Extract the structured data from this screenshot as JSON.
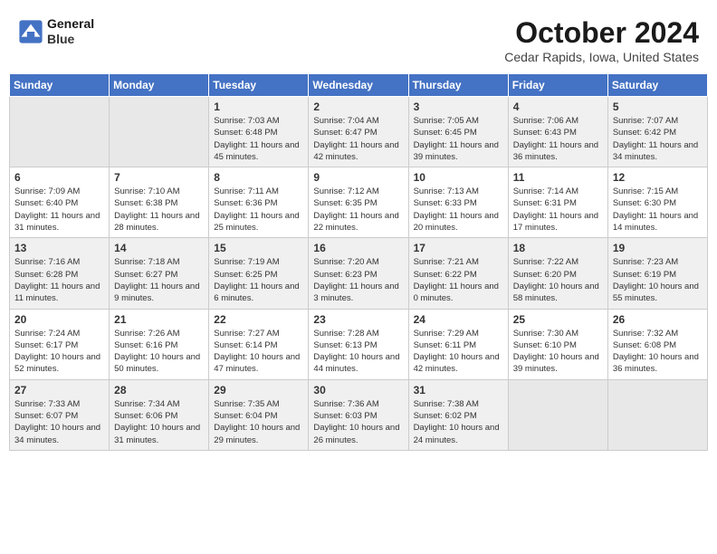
{
  "header": {
    "logo_line1": "General",
    "logo_line2": "Blue",
    "month": "October 2024",
    "location": "Cedar Rapids, Iowa, United States"
  },
  "weekdays": [
    "Sunday",
    "Monday",
    "Tuesday",
    "Wednesday",
    "Thursday",
    "Friday",
    "Saturday"
  ],
  "weeks": [
    [
      {
        "day": "",
        "info": ""
      },
      {
        "day": "",
        "info": ""
      },
      {
        "day": "1",
        "info": "Sunrise: 7:03 AM\nSunset: 6:48 PM\nDaylight: 11 hours and 45 minutes."
      },
      {
        "day": "2",
        "info": "Sunrise: 7:04 AM\nSunset: 6:47 PM\nDaylight: 11 hours and 42 minutes."
      },
      {
        "day": "3",
        "info": "Sunrise: 7:05 AM\nSunset: 6:45 PM\nDaylight: 11 hours and 39 minutes."
      },
      {
        "day": "4",
        "info": "Sunrise: 7:06 AM\nSunset: 6:43 PM\nDaylight: 11 hours and 36 minutes."
      },
      {
        "day": "5",
        "info": "Sunrise: 7:07 AM\nSunset: 6:42 PM\nDaylight: 11 hours and 34 minutes."
      }
    ],
    [
      {
        "day": "6",
        "info": "Sunrise: 7:09 AM\nSunset: 6:40 PM\nDaylight: 11 hours and 31 minutes."
      },
      {
        "day": "7",
        "info": "Sunrise: 7:10 AM\nSunset: 6:38 PM\nDaylight: 11 hours and 28 minutes."
      },
      {
        "day": "8",
        "info": "Sunrise: 7:11 AM\nSunset: 6:36 PM\nDaylight: 11 hours and 25 minutes."
      },
      {
        "day": "9",
        "info": "Sunrise: 7:12 AM\nSunset: 6:35 PM\nDaylight: 11 hours and 22 minutes."
      },
      {
        "day": "10",
        "info": "Sunrise: 7:13 AM\nSunset: 6:33 PM\nDaylight: 11 hours and 20 minutes."
      },
      {
        "day": "11",
        "info": "Sunrise: 7:14 AM\nSunset: 6:31 PM\nDaylight: 11 hours and 17 minutes."
      },
      {
        "day": "12",
        "info": "Sunrise: 7:15 AM\nSunset: 6:30 PM\nDaylight: 11 hours and 14 minutes."
      }
    ],
    [
      {
        "day": "13",
        "info": "Sunrise: 7:16 AM\nSunset: 6:28 PM\nDaylight: 11 hours and 11 minutes."
      },
      {
        "day": "14",
        "info": "Sunrise: 7:18 AM\nSunset: 6:27 PM\nDaylight: 11 hours and 9 minutes."
      },
      {
        "day": "15",
        "info": "Sunrise: 7:19 AM\nSunset: 6:25 PM\nDaylight: 11 hours and 6 minutes."
      },
      {
        "day": "16",
        "info": "Sunrise: 7:20 AM\nSunset: 6:23 PM\nDaylight: 11 hours and 3 minutes."
      },
      {
        "day": "17",
        "info": "Sunrise: 7:21 AM\nSunset: 6:22 PM\nDaylight: 11 hours and 0 minutes."
      },
      {
        "day": "18",
        "info": "Sunrise: 7:22 AM\nSunset: 6:20 PM\nDaylight: 10 hours and 58 minutes."
      },
      {
        "day": "19",
        "info": "Sunrise: 7:23 AM\nSunset: 6:19 PM\nDaylight: 10 hours and 55 minutes."
      }
    ],
    [
      {
        "day": "20",
        "info": "Sunrise: 7:24 AM\nSunset: 6:17 PM\nDaylight: 10 hours and 52 minutes."
      },
      {
        "day": "21",
        "info": "Sunrise: 7:26 AM\nSunset: 6:16 PM\nDaylight: 10 hours and 50 minutes."
      },
      {
        "day": "22",
        "info": "Sunrise: 7:27 AM\nSunset: 6:14 PM\nDaylight: 10 hours and 47 minutes."
      },
      {
        "day": "23",
        "info": "Sunrise: 7:28 AM\nSunset: 6:13 PM\nDaylight: 10 hours and 44 minutes."
      },
      {
        "day": "24",
        "info": "Sunrise: 7:29 AM\nSunset: 6:11 PM\nDaylight: 10 hours and 42 minutes."
      },
      {
        "day": "25",
        "info": "Sunrise: 7:30 AM\nSunset: 6:10 PM\nDaylight: 10 hours and 39 minutes."
      },
      {
        "day": "26",
        "info": "Sunrise: 7:32 AM\nSunset: 6:08 PM\nDaylight: 10 hours and 36 minutes."
      }
    ],
    [
      {
        "day": "27",
        "info": "Sunrise: 7:33 AM\nSunset: 6:07 PM\nDaylight: 10 hours and 34 minutes."
      },
      {
        "day": "28",
        "info": "Sunrise: 7:34 AM\nSunset: 6:06 PM\nDaylight: 10 hours and 31 minutes."
      },
      {
        "day": "29",
        "info": "Sunrise: 7:35 AM\nSunset: 6:04 PM\nDaylight: 10 hours and 29 minutes."
      },
      {
        "day": "30",
        "info": "Sunrise: 7:36 AM\nSunset: 6:03 PM\nDaylight: 10 hours and 26 minutes."
      },
      {
        "day": "31",
        "info": "Sunrise: 7:38 AM\nSunset: 6:02 PM\nDaylight: 10 hours and 24 minutes."
      },
      {
        "day": "",
        "info": ""
      },
      {
        "day": "",
        "info": ""
      }
    ]
  ]
}
